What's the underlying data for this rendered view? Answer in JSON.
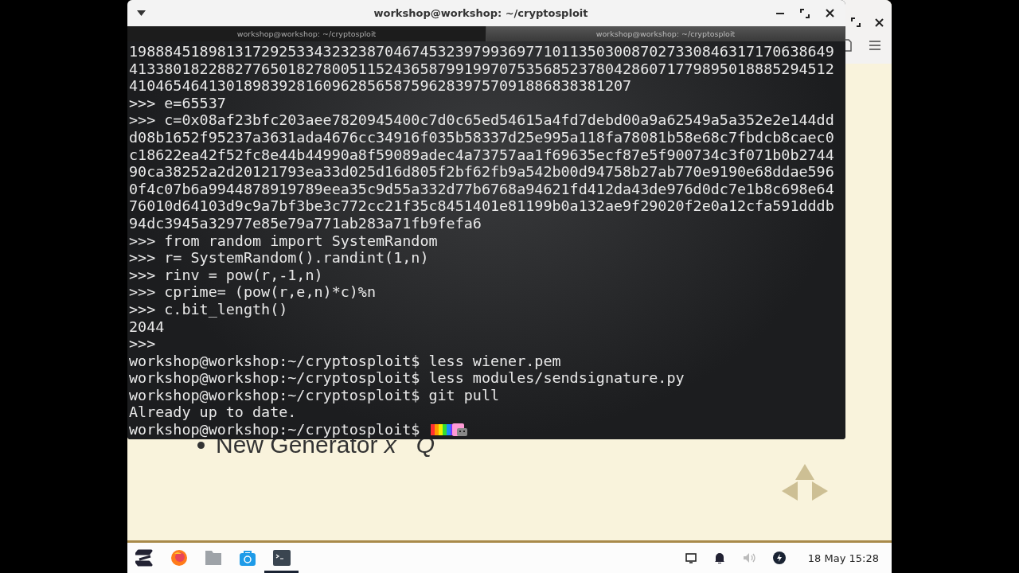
{
  "viewer": {
    "slide_bullet": "New Generator *x*   *Q*"
  },
  "terminal": {
    "title": "workshop@workshop: ~/cryptosploit",
    "tabs": [
      {
        "label": "workshop@workshop: ~/cryptosploit",
        "selected": false
      },
      {
        "label": "workshop@workshop: ~/cryptosploit",
        "selected": true
      }
    ],
    "lines": [
      "19888451898131729253343232387046745323979936977101135030087027330846317170638649",
      "41338018228827765018278005115243658799199707535685237804286071779895018885294512",
      "410465464130189839281609628565875962839757091886838381207",
      ">>> e=65537",
      ">>> c=0x08af23bfc203aee7820945400c7d0c65ed54615a4fd7debd00a9a62549a5a352e2e144dd",
      "d08b1652f95237a3631ada4676cc34916f035b58337d25e995a118fa78081b58e68c7fbdcb8caec0",
      "c18622ea42f52fc8e44b44990a8f59089adec4a73757aa1f69635ecf87e5f900734c3f071b0b2744",
      "90ca38252a2d20121793ea33d025d16d805f2bf62fb9a542b00d94758b27ab770e9190e68ddae596",
      "0f4c07b6a9944878919789eea35c9d55a332d77b6768a94621fd412da43de976d0dc7e1b8c698e64",
      "76010d64103d9c9a7bf3be3c772cc21f35c8451401e81199b0a132ae9f29020f2e0a12cfa591dddb",
      "94dc3945a32977e85e79a771ab283a71fb9fefa6",
      ">>> from random import SystemRandom",
      ">>> r= SystemRandom().randint(1,n)",
      ">>> rinv = pow(r,-1,n)",
      ">>> cprime= (pow(r,e,n)*c)%n",
      ">>> c.bit_length()",
      "2044",
      ">>>",
      "workshop@workshop:~/cryptosploit$ less wiener.pem",
      "workshop@workshop:~/cryptosploit$ less modules/sendsignature.py",
      "workshop@workshop:~/cryptosploit$ git pull",
      "Already up to date.",
      "workshop@workshop:~/cryptosploit$"
    ]
  },
  "taskbar": {
    "apps": [
      {
        "kind": "zorin",
        "selected": false
      },
      {
        "kind": "firefox",
        "selected": false
      },
      {
        "kind": "files",
        "selected": false
      },
      {
        "kind": "store",
        "selected": false
      },
      {
        "kind": "terminal",
        "selected": true
      }
    ],
    "clock": "18 May 15:28"
  }
}
